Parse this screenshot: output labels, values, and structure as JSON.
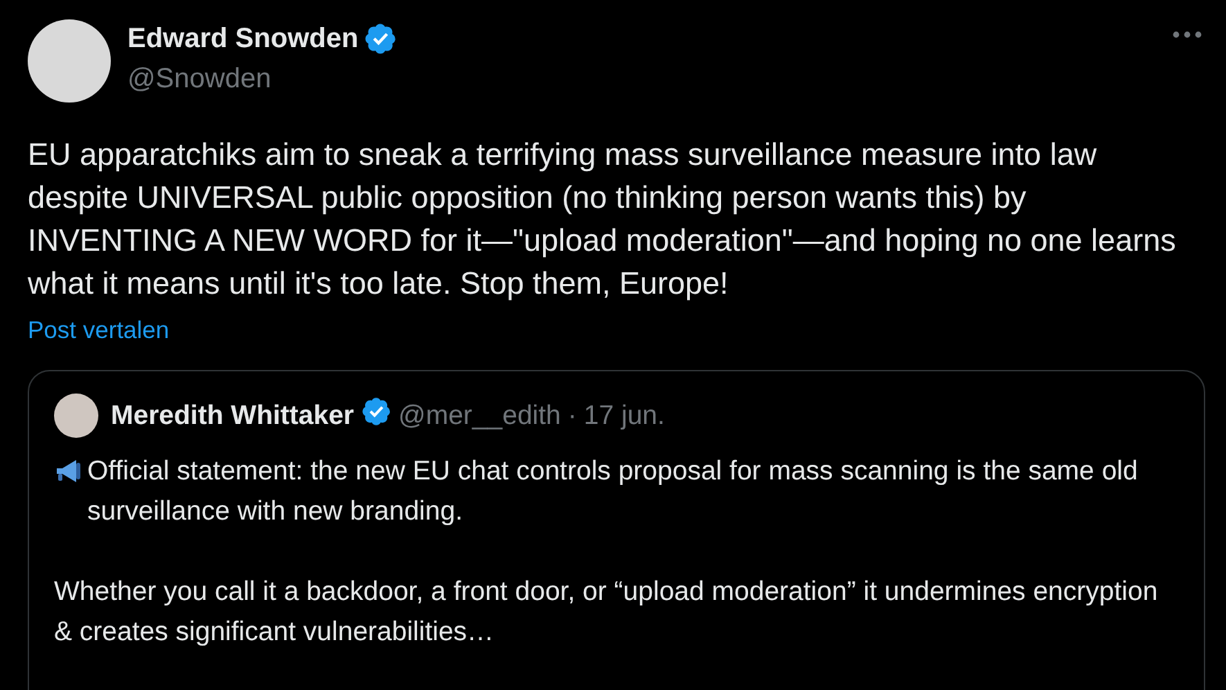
{
  "post": {
    "author": {
      "name": "Edward Snowden",
      "handle": "@Snowden",
      "verified": true
    },
    "text": "EU apparatchiks aim to sneak a terrifying mass surveillance measure into law despite UNIVERSAL public opposition (no thinking person wants this) by INVENTING A NEW WORD for it—\"upload moderation\"—and hoping no one learns what it means until it's too late. Stop them, Europe!",
    "translate_link": "Post vertalen",
    "quoted_post": {
      "author": {
        "name": "Meredith Whittaker",
        "handle": "@mer__edith",
        "verified": true
      },
      "separator": "·",
      "date": "17 jun.",
      "paragraphs": [
        "Official statement: the new EU chat controls proposal for mass scanning is the same old surveillance with new branding.",
        "Whether you call it a backdoor, a front door, or “upload moderation” it undermines encryption & creates significant vulnerabilities…"
      ]
    }
  }
}
